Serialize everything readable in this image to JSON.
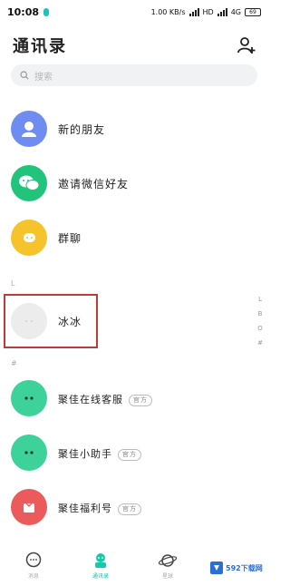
{
  "status_bar": {
    "time": "10:08",
    "speed": "1.00 KB/s",
    "network": "HD",
    "network2": "4G",
    "battery": "69"
  },
  "header": {
    "title": "通讯录"
  },
  "search": {
    "placeholder": "搜索"
  },
  "special_items": [
    {
      "label": "新的朋友",
      "color": "#6f8df0",
      "icon": "person-icon"
    },
    {
      "label": "邀请微信好友",
      "color": "#21c47a",
      "icon": "wechat-icon"
    },
    {
      "label": "群聊",
      "color": "#f5c42c",
      "icon": "group-chat-icon"
    }
  ],
  "section_letters": [
    "L",
    "#"
  ],
  "contacts": [
    {
      "label": "冰冰",
      "color": "#ececec"
    }
  ],
  "index_bar": [
    "L",
    "B",
    "O",
    "#"
  ],
  "official_accounts": [
    {
      "label": "聚佳在线客服",
      "badge": "官方",
      "color": "#3cd29a"
    },
    {
      "label": "聚佳小助手",
      "badge": "官方",
      "color": "#3cd29a"
    },
    {
      "label": "聚佳福利号",
      "badge": "官方",
      "color": "#ec5b5b"
    }
  ],
  "tab_bar": [
    {
      "label": "消息",
      "icon": "chat-bubble-icon",
      "active": false
    },
    {
      "label": "通讯录",
      "icon": "contacts-icon",
      "active": true
    },
    {
      "label": "星球",
      "icon": "planet-icon",
      "active": false
    }
  ],
  "watermark": {
    "text": "592下载网"
  }
}
